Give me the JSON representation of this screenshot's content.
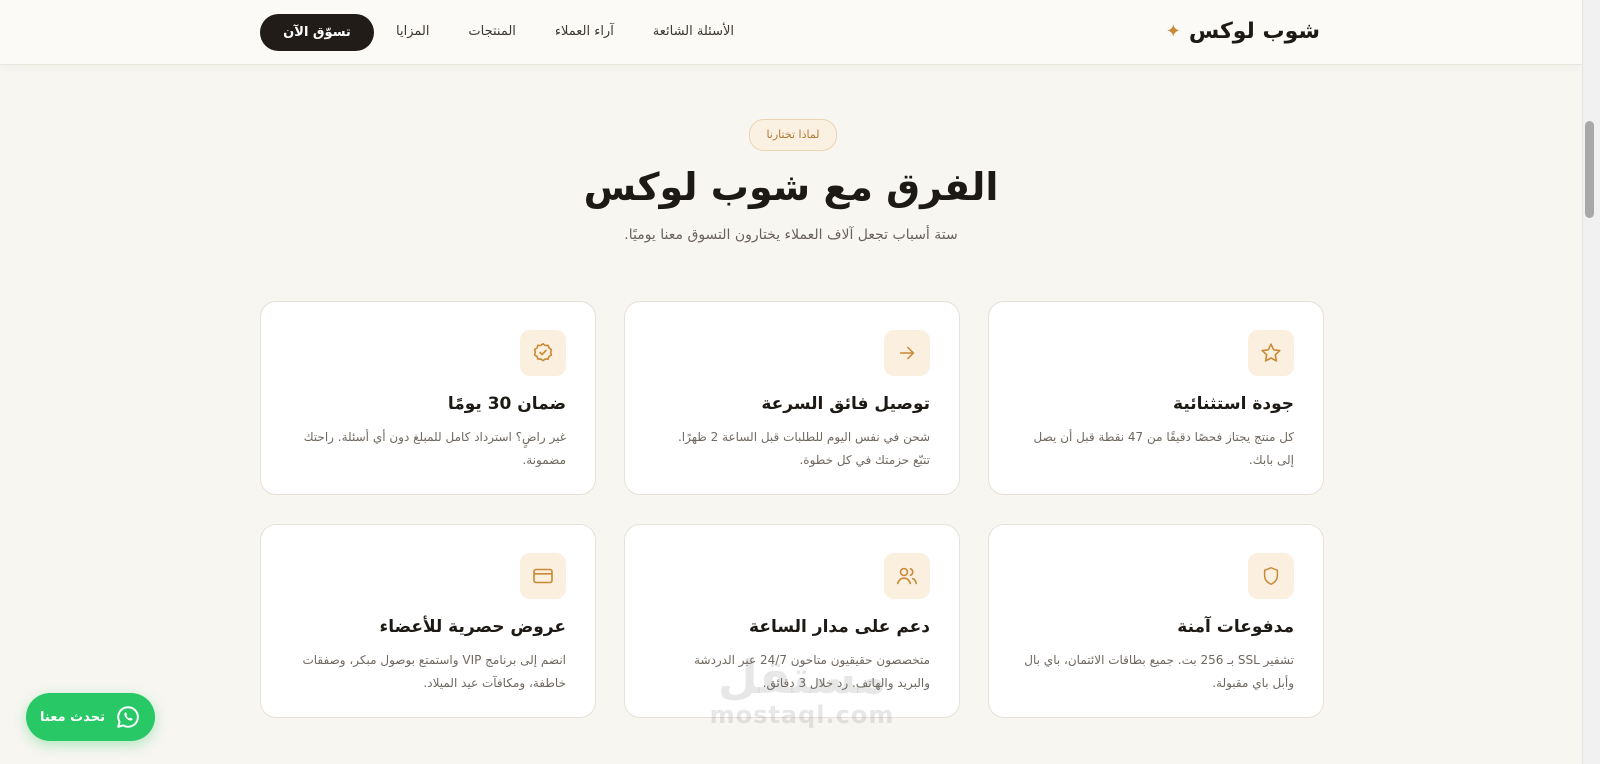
{
  "header": {
    "brand_name": "شوب لوكس",
    "brand_star": "✦",
    "nav": [
      {
        "label": "المزايا"
      },
      {
        "label": "المنتجات"
      },
      {
        "label": "آراء العملاء"
      },
      {
        "label": "الأسئلة الشائعة"
      }
    ],
    "cta_label": "تسوّق الآن"
  },
  "hero": {
    "badge": "لماذا تختارنا",
    "title": "الفرق مع شوب لوكس",
    "subtitle": "ستة أسباب تجعل آلاف العملاء يختارون التسوق معنا يوميًا."
  },
  "features": [
    {
      "icon": "star-icon",
      "title": "جودة استثنائية",
      "desc": "كل منتج يجتاز فحصًا دقيقًا من 47 نقطة قبل أن يصل إلى بابك."
    },
    {
      "icon": "arrow-right-icon",
      "title": "توصيل فائق السرعة",
      "desc": "شحن في نفس اليوم للطلبات قبل الساعة 2 ظهرًا. تتبّع حزمتك في كل خطوة."
    },
    {
      "icon": "badge-check-icon",
      "title": "ضمان 30 يومًا",
      "desc": "غير راضٍ؟ استرداد كامل للمبلغ دون أي أسئلة. راحتك مضمونة."
    },
    {
      "icon": "shield-icon",
      "title": "مدفوعات آمنة",
      "desc": "تشفير SSL بـ 256 بت. جميع بطاقات الائتمان، باي بال وأبل باي مقبولة."
    },
    {
      "icon": "users-icon",
      "title": "دعم على مدار الساعة",
      "desc": "متخصصون حقيقيون متاحون 24/7 عبر الدردشة والبريد والهاتف. رد خلال 3 دقائق."
    },
    {
      "icon": "credit-card-icon",
      "title": "عروض حصرية للأعضاء",
      "desc": "انضم إلى برنامج VIP واستمتع بوصول مبكر، وصفقات خاطفة، ومكافآت عيد الميلاد."
    }
  ],
  "whatsapp": {
    "label": "تحدث معنا",
    "icon": "whatsapp-icon"
  },
  "watermark": {
    "logo": "مستقل",
    "url": "mostaql.com"
  },
  "colors": {
    "accent": "#c98a35",
    "dark": "#211c18",
    "whatsapp": "#27c865",
    "icon_bg": "#fbefdf"
  }
}
